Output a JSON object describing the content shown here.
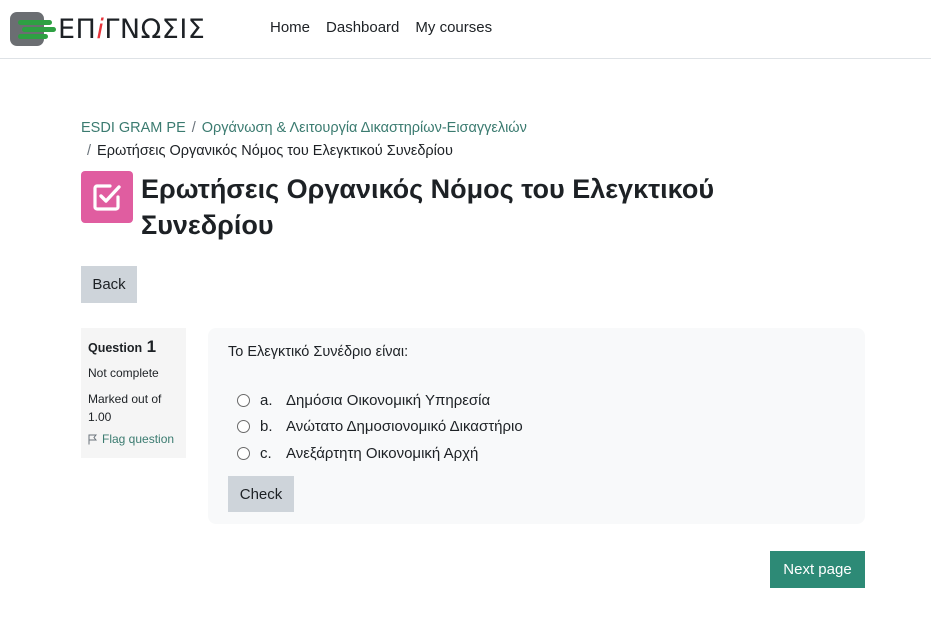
{
  "header": {
    "logo_text_pre": "ΕΠ",
    "logo_text_accent": "i",
    "logo_text_post": "ΓΝΩΣΙΣ",
    "nav": [
      "Home",
      "Dashboard",
      "My courses"
    ]
  },
  "breadcrumb": {
    "items": [
      "ESDI GRAM PE",
      "Οργάνωση & Λειτουργία Δικαστηρίων-Εισαγγελιών"
    ],
    "current": "Ερωτήσεις Οργανικός Νόμος του Ελεγκτικού Συνεδρίου",
    "separator": "/"
  },
  "page": {
    "title": "Ερωτήσεις Οργανικός Νόμος του Ελεγκτικού Συνεδρίου",
    "icon": "quiz-checkbox-icon",
    "back_label": "Back"
  },
  "question": {
    "label": "Question",
    "number": "1",
    "state": "Not complete",
    "grade": "Marked out of 1.00",
    "flag_label": "Flag question",
    "text": "Το Ελεγκτικό Συνέδριο είναι:",
    "answers": [
      {
        "letter": "a.",
        "text": "Δημόσια Οικονομική Υπηρεσία"
      },
      {
        "letter": "b.",
        "text": "Ανώτατο Δημοσιονομικό Δικαστήριο"
      },
      {
        "letter": "c.",
        "text": "Ανεξάρτητη Οικονομική Αρχή"
      }
    ],
    "check_label": "Check"
  },
  "footer": {
    "next_label": "Next page"
  },
  "colors": {
    "accent": "#2d8a76",
    "link": "#3b7b70",
    "quiz_icon": "#e05da0",
    "button_gray": "#ced4da"
  }
}
